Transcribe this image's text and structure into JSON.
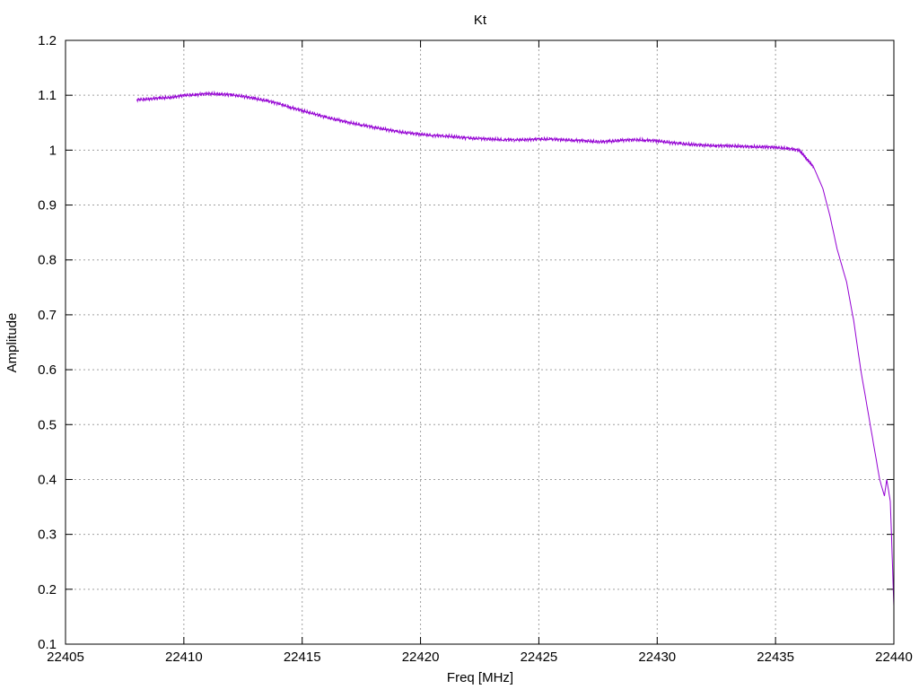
{
  "chart_data": {
    "type": "line",
    "title": "Kt",
    "xlabel": "Freq [MHz]",
    "ylabel": "Amplitude",
    "xlim": [
      22405,
      22440
    ],
    "ylim": [
      0.1,
      1.2
    ],
    "xticks": [
      "22405",
      "22410",
      "22415",
      "22420",
      "22425",
      "22430",
      "22435",
      "22440"
    ],
    "yticks": [
      "0.1",
      "0.2",
      "0.3",
      "0.4",
      "0.5",
      "0.6",
      "0.7",
      "0.8",
      "0.9",
      "1",
      "1.1",
      "1.2"
    ],
    "grid": true,
    "legend": "none",
    "line_color": "#9400d3",
    "series": [
      {
        "x": [
          22408.0,
          22408.5,
          22409.0,
          22409.5,
          22410.0,
          22410.5,
          22411.0,
          22411.5,
          22412.0,
          22412.5,
          22413.0,
          22413.5,
          22414.0,
          22414.5,
          22415.0,
          22415.5,
          22416.0,
          22416.5,
          22417.0,
          22417.5,
          22418.0,
          22418.5,
          22419.0,
          22419.5,
          22420.0,
          22420.5,
          22421.0,
          22421.5,
          22422.0,
          22422.5,
          22423.0,
          22423.5,
          22424.0,
          22424.5,
          22425.0,
          22425.5,
          22426.0,
          22426.5,
          22427.0,
          22427.5,
          22428.0,
          22428.5,
          22429.0,
          22429.5,
          22430.0,
          22430.5,
          22431.0,
          22431.5,
          22432.0,
          22432.5,
          22433.0,
          22433.5,
          22434.0,
          22434.5,
          22435.0,
          22435.5,
          22436.0,
          22436.3,
          22436.6,
          22437.0,
          22437.3,
          22437.6,
          22438.0,
          22438.3,
          22438.6,
          22439.0,
          22439.2,
          22439.4,
          22439.6,
          22439.7,
          22439.85,
          22440.0
        ],
        "y": [
          1.092,
          1.093,
          1.095,
          1.096,
          1.1,
          1.101,
          1.103,
          1.102,
          1.101,
          1.098,
          1.094,
          1.09,
          1.085,
          1.078,
          1.072,
          1.066,
          1.06,
          1.055,
          1.05,
          1.046,
          1.042,
          1.038,
          1.034,
          1.031,
          1.029,
          1.027,
          1.026,
          1.024,
          1.022,
          1.021,
          1.02,
          1.019,
          1.019,
          1.019,
          1.02,
          1.02,
          1.019,
          1.018,
          1.017,
          1.015,
          1.016,
          1.018,
          1.019,
          1.018,
          1.017,
          1.014,
          1.012,
          1.01,
          1.009,
          1.008,
          1.008,
          1.007,
          1.006,
          1.006,
          1.005,
          1.003,
          1.0,
          0.985,
          0.97,
          0.93,
          0.88,
          0.82,
          0.76,
          0.69,
          0.6,
          0.5,
          0.45,
          0.4,
          0.37,
          0.4,
          0.36,
          0.17
        ]
      }
    ]
  }
}
